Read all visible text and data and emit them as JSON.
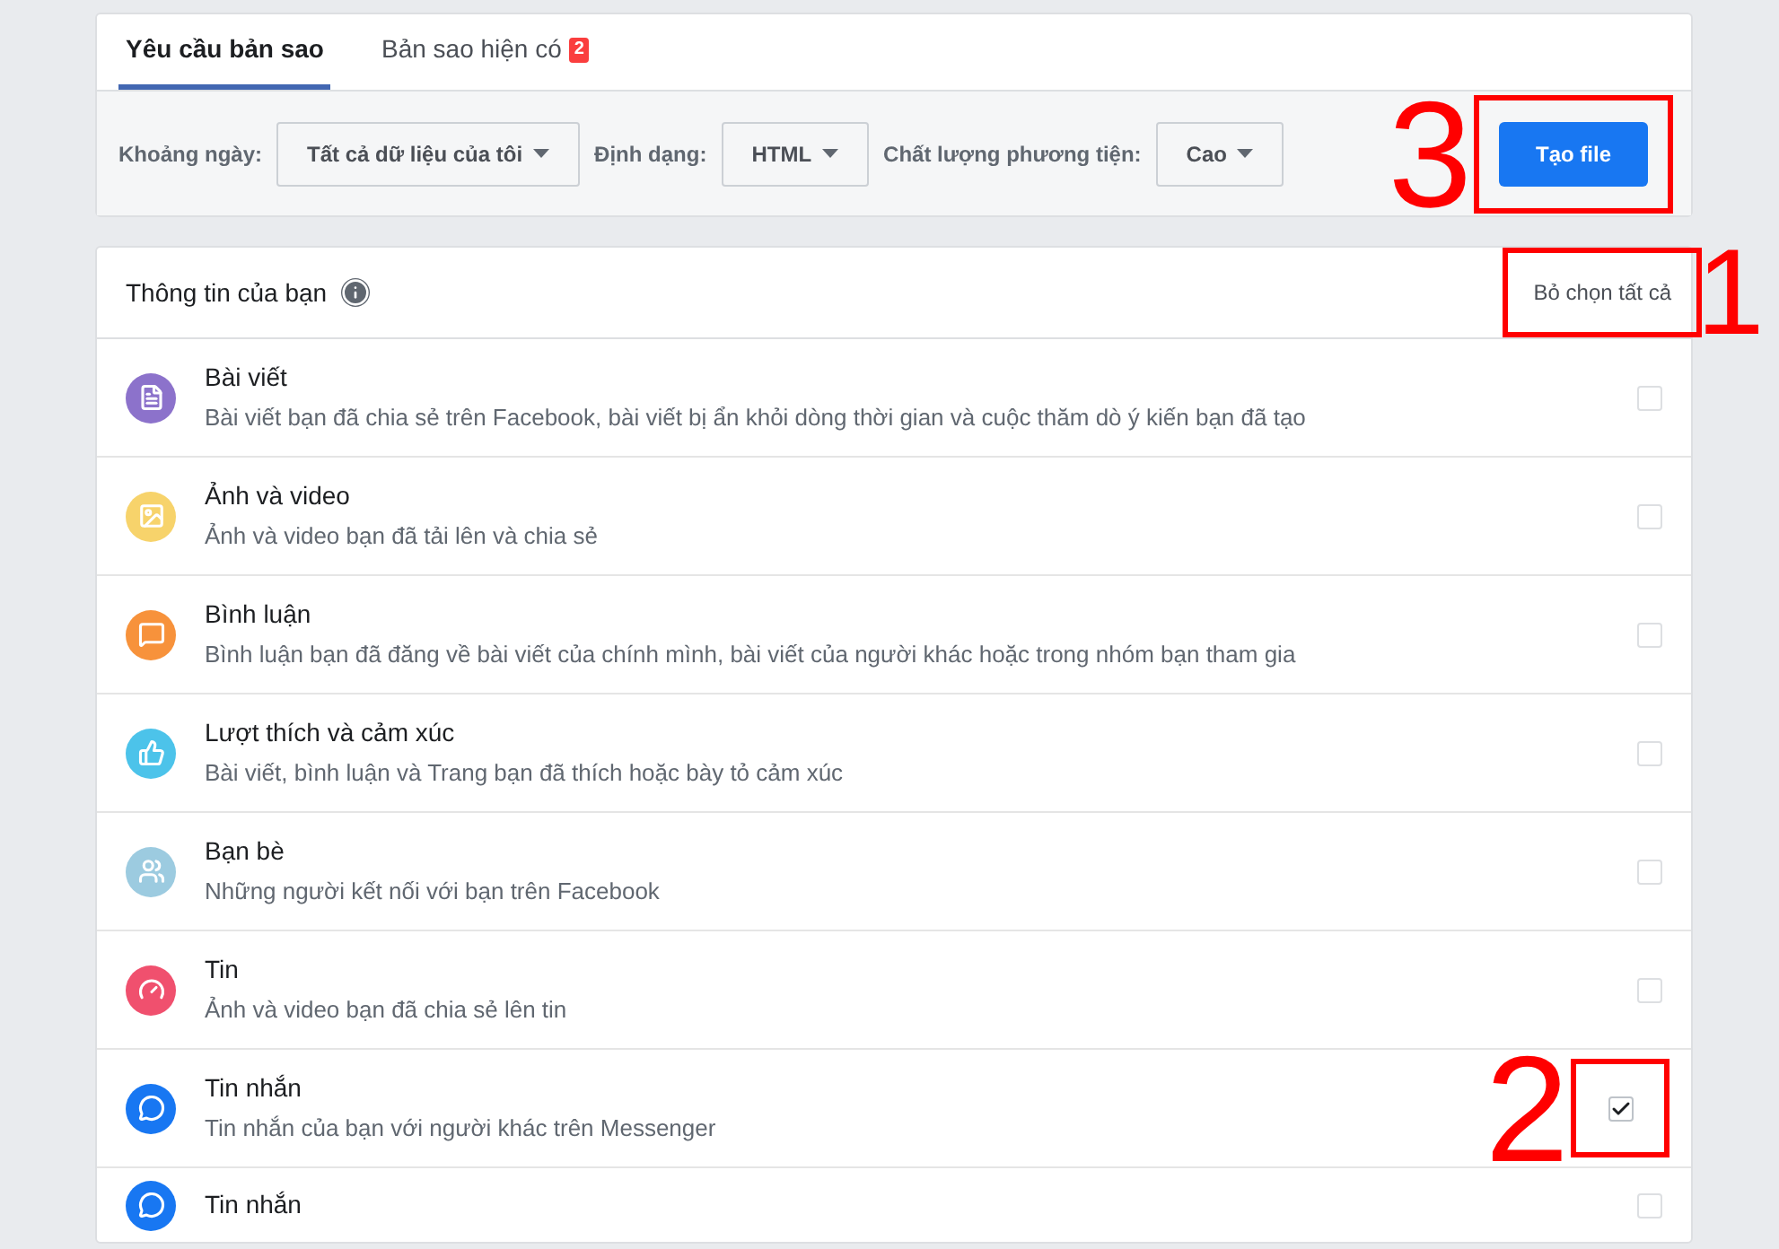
{
  "tabs": [
    {
      "label": "Yêu cầu bản sao",
      "selected": true
    },
    {
      "label": "Bản sao hiện có",
      "selected": false,
      "badge": "2"
    }
  ],
  "filters": [
    {
      "label": "Khoảng ngày:",
      "value": "Tất cả dữ liệu của tôi"
    },
    {
      "label": "Định dạng:",
      "value": "HTML"
    },
    {
      "label": "Chất lượng phương tiện:",
      "value": "Cao"
    }
  ],
  "create_button": {
    "label": "Tạo file",
    "annotation": "3"
  },
  "section": {
    "title": "Thông tin của bạn",
    "select_all": {
      "label": "Bỏ chọn tất cả",
      "annotation": "1"
    }
  },
  "items": [
    {
      "title": "Bài viết",
      "description": "Bài viết bạn đã chia sẻ trên Facebook, bài viết bị ẩn khỏi dòng thời gian và cuộc thăm dò ý kiến bạn đã tạo",
      "color": "#8c72cb",
      "checked": false
    },
    {
      "title": "Ảnh và video",
      "description": "Ảnh và video bạn đã tải lên và chia sẻ",
      "color": "#f7d36b",
      "checked": false
    },
    {
      "title": "Bình luận",
      "description": "Bình luận bạn đã đăng về bài viết của chính mình, bài viết của người khác hoặc trong nhóm bạn tham gia",
      "color": "#f7923b",
      "checked": false
    },
    {
      "title": "Lượt thích và cảm xúc",
      "description": "Bài viết, bình luận và Trang bạn đã thích hoặc bày tỏ cảm xúc",
      "color": "#4cc3ea",
      "checked": false
    },
    {
      "title": "Bạn bè",
      "description": "Những người kết nối với bạn trên Facebook",
      "color": "#9ccbe0",
      "checked": false
    },
    {
      "title": "Tin",
      "description": "Ảnh và video bạn đã chia sẻ lên tin",
      "color": "#f0506e",
      "checked": false
    },
    {
      "title": "Tin nhắn",
      "description": "Tin nhắn của bạn với người khác trên Messenger",
      "color": "#1877f2",
      "checked": true,
      "annotation": "2"
    },
    {
      "title": "Tin nhắn",
      "color": "#1877f2",
      "checked": false
    }
  ]
}
